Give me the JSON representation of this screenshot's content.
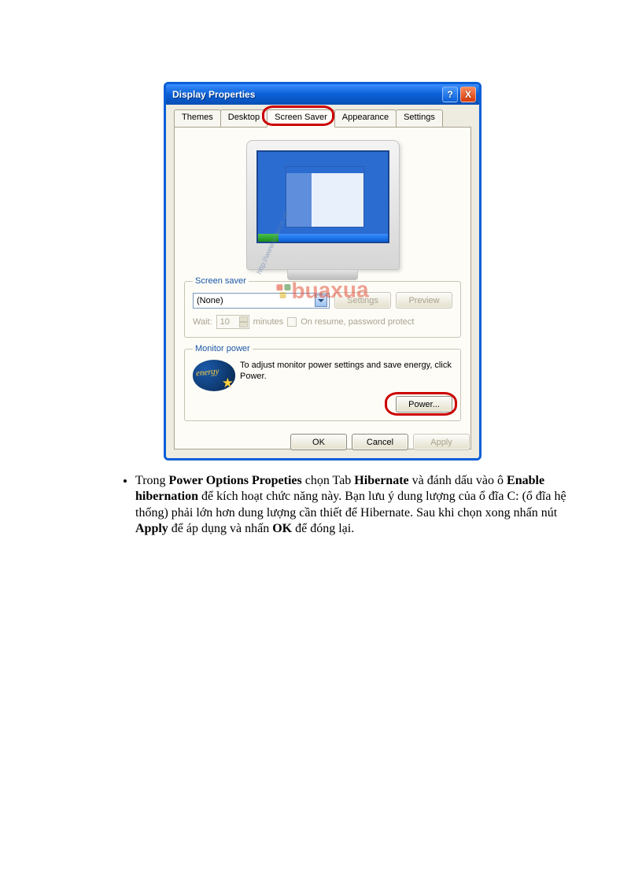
{
  "dialog": {
    "title": "Display Properties",
    "helpGlyph": "?",
    "closeGlyph": "X",
    "tabs": [
      "Themes",
      "Desktop",
      "Screen Saver",
      "Appearance",
      "Settings"
    ],
    "activeTab": "Screen Saver"
  },
  "screenSaver": {
    "legend": "Screen saver",
    "selected": "(None)",
    "settingsBtn": "Settings",
    "previewBtn": "Preview",
    "waitLabel": "Wait:",
    "waitValue": "10",
    "waitUnit": "minutes",
    "resumeLabel": "On resume, password protect"
  },
  "monitorPower": {
    "legend": "Monitor power",
    "iconText": "energy",
    "desc": "To adjust monitor power settings and save energy, click Power.",
    "powerBtn": "Power..."
  },
  "buttons": {
    "ok": "OK",
    "cancel": "Cancel",
    "apply": "Apply"
  },
  "watermark": {
    "small": "http://www.buaxua.vn",
    "text": "buaxua"
  },
  "instruction": {
    "p1a": "Trong ",
    "p1b": "Power Options Propeties",
    "p1c": " chọn Tab ",
    "p1d": "Hibernate",
    "p1e": " và đánh dấu vào ô ",
    "p1f": "Enable hibernation",
    "p1g": " để kích hoạt chức năng này. Bạn lưu ý dung lượng của ổ đĩa C: (ổ đĩa hệ thống) phải lớn hơn dung lượng cần thiết để Hibernate. Sau khi chọn xong nhấn nút ",
    "p1h": "Apply",
    "p1i": " để áp dụng và nhấn ",
    "p1j": "OK",
    "p1k": " để đóng lại."
  }
}
